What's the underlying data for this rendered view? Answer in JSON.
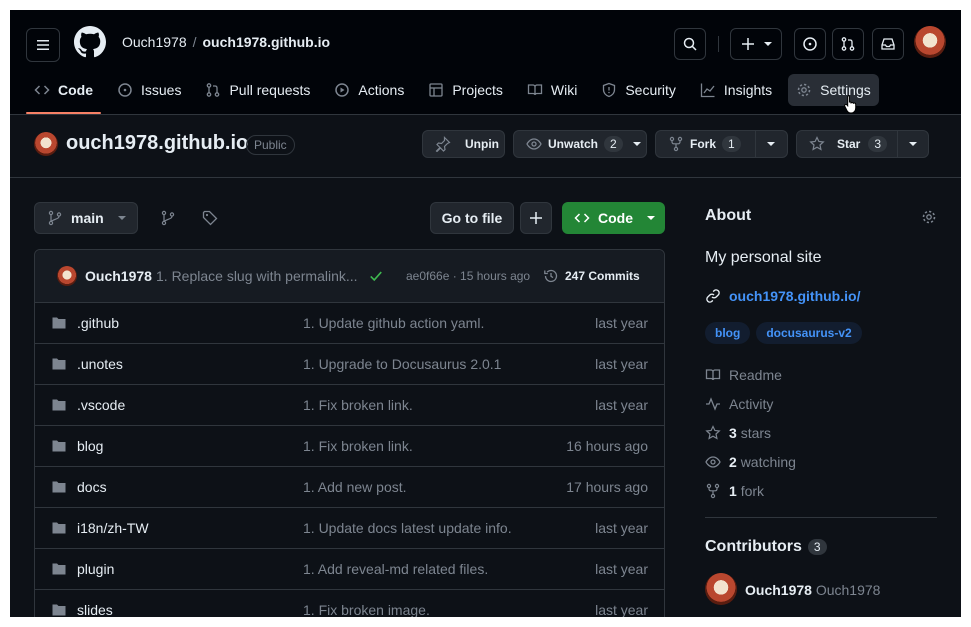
{
  "header": {
    "owner": "Ouch1978",
    "separator": "/",
    "repo": "ouch1978.github.io"
  },
  "tabs": [
    {
      "label": "Code",
      "icon": "code-icon"
    },
    {
      "label": "Issues",
      "icon": "issue-icon"
    },
    {
      "label": "Pull requests",
      "icon": "pull-request-icon"
    },
    {
      "label": "Actions",
      "icon": "play-icon"
    },
    {
      "label": "Projects",
      "icon": "table-icon"
    },
    {
      "label": "Wiki",
      "icon": "book-icon"
    },
    {
      "label": "Security",
      "icon": "shield-icon"
    },
    {
      "label": "Insights",
      "icon": "graph-icon"
    },
    {
      "label": "Settings",
      "icon": "gear-icon"
    }
  ],
  "repo_header": {
    "name": "ouch1978.github.io",
    "visibility": "Public",
    "unpin": "Unpin",
    "unwatch": "Unwatch",
    "watch_count": "2",
    "fork": "Fork",
    "fork_count": "1",
    "star": "Star",
    "star_count": "3"
  },
  "toolbar": {
    "branch": "main",
    "goto_file": "Go to file",
    "code": "Code"
  },
  "commit": {
    "user": "Ouch1978",
    "message": "1. Replace slug with permalink...",
    "sha_time": "ae0f66e · 15 hours ago",
    "count_label": "247 Commits"
  },
  "files": [
    {
      "name": ".github",
      "message": "1. Update github action yaml.",
      "time": "last year"
    },
    {
      "name": ".unotes",
      "message": "1. Upgrade to Docusaurus 2.0.1",
      "time": "last year"
    },
    {
      "name": ".vscode",
      "message": "1. Fix broken link.",
      "time": "last year"
    },
    {
      "name": "blog",
      "message": "1. Fix broken link.",
      "time": "16 hours ago"
    },
    {
      "name": "docs",
      "message": "1. Add new post.",
      "time": "17 hours ago"
    },
    {
      "name": "i18n/zh-TW",
      "message": "1. Update docs latest update info.",
      "time": "last year"
    },
    {
      "name": "plugin",
      "message": "1. Add reveal-md related files.",
      "time": "last year"
    },
    {
      "name": "slides",
      "message": "1. Fix broken image.",
      "time": "last year"
    }
  ],
  "about": {
    "title": "About",
    "description": "My personal site",
    "link": "ouch1978.github.io/",
    "topics": [
      "blog",
      "docusaurus-v2"
    ],
    "readme": "Readme",
    "activity": "Activity",
    "stars_num": "3",
    "stars_label": "stars",
    "watching_num": "2",
    "watching_label": "watching",
    "fork_num": "1",
    "fork_label": "fork"
  },
  "contributors": {
    "title": "Contributors",
    "count": "3",
    "first_login": "Ouch1978",
    "first_name": "Ouch1978"
  },
  "colors": {
    "background": "#0d1117",
    "header": "#010409",
    "border": "#30363d",
    "accent_blue": "#4493f8",
    "primary_green": "#238636",
    "tab_underline": "#f78166"
  }
}
